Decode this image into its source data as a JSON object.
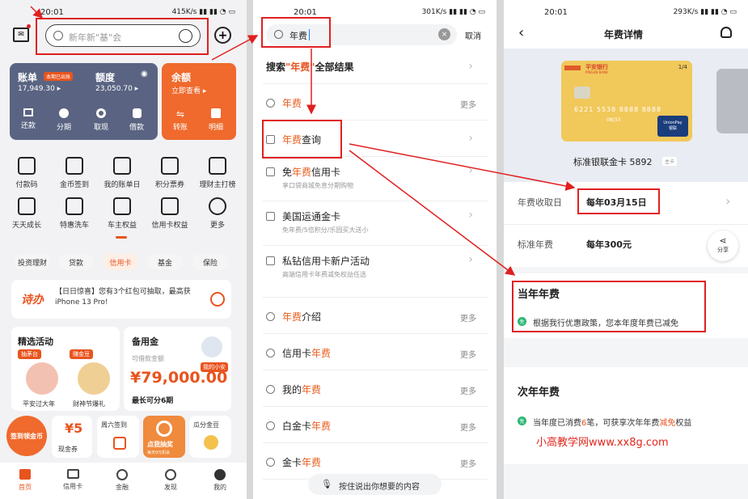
{
  "time": "20:01",
  "p1": {
    "speed": "415K/s",
    "search_placeholder": "新年新\"基\"会",
    "bill": {
      "label": "账单",
      "badge": "本期已出账",
      "value": "17,949.30 ▸",
      "quota_label": "额度",
      "quota_value": "23,050.70 ▸",
      "balance_label": "余额",
      "balance_value": "立即查看 ▸"
    },
    "quick": [
      "还款",
      "分期",
      "取现",
      "借款",
      "转账",
      "明细"
    ],
    "grid": [
      "付款码",
      "金币签到",
      "我的账单日",
      "积分票券",
      "理财主打榜",
      "天天成长",
      "特惠洗车",
      "车主权益",
      "信用卡权益",
      "更多"
    ],
    "chips": [
      "投资理财",
      "贷款",
      "信用卡",
      "基金",
      "保险"
    ],
    "promo": {
      "logo": "诗办",
      "text": "【日日惊喜】您有3个红包可抽取，最高获iPhone 13 Pro!"
    },
    "activity": {
      "title": "精选活动",
      "tag1": "抽茅台",
      "tag2": "赚金豆",
      "item1": "平安过大年",
      "item2": "财神节爆礼"
    },
    "reserve": {
      "title": "备用金",
      "sub": "可借款金额",
      "amount": "¥79,000.00",
      "term": "最长可分6期",
      "bot": "我的小安"
    },
    "bottom_cards": {
      "sign": "签到领金币",
      "cash_num": "¥5",
      "cash": "现金券",
      "week": "周六签到",
      "draw": "点我抽奖",
      "draw_sub": "每天0元机会",
      "gold": "瓜分金豆"
    },
    "tabs": [
      "首页",
      "信用卡",
      "金融",
      "发现",
      "我的"
    ]
  },
  "p2": {
    "speed": "301K/s",
    "query": "年费",
    "cancel": "取消",
    "all_pre": "搜索",
    "all_kw": "\"年费\"",
    "all_post": "全部结果",
    "rows": [
      {
        "pre": "",
        "kw": "年费",
        "post": "",
        "more": "更多",
        "sub": ""
      },
      {
        "pre": "",
        "kw": "年费",
        "post": "查询",
        "more": "",
        "sub": ""
      },
      {
        "pre": "免",
        "kw": "年费",
        "post": "信用卡",
        "more": "",
        "sub": "享口袋商城免息分期购物"
      },
      {
        "pre": "美国运通金卡",
        "kw": "",
        "post": "",
        "more": "",
        "sub": "免年费/5倍积分/乐园买大送小"
      },
      {
        "pre": "私钻信用卡新户活动",
        "kw": "",
        "post": "",
        "more": "",
        "sub": "高端信用卡年费减免权益任选"
      },
      {
        "pre": "",
        "kw": "年费",
        "post": "介绍",
        "more": "更多",
        "sub": ""
      },
      {
        "pre": "信用卡",
        "kw": "年费",
        "post": "",
        "more": "更多",
        "sub": ""
      },
      {
        "pre": "我的",
        "kw": "年费",
        "post": "",
        "more": "更多",
        "sub": ""
      },
      {
        "pre": "白金卡",
        "kw": "年费",
        "post": "",
        "more": "更多",
        "sub": ""
      },
      {
        "pre": "金卡",
        "kw": "年费",
        "post": "",
        "more": "更多",
        "sub": ""
      }
    ],
    "voice": "按住说出你想要的内容"
  },
  "p3": {
    "speed": "293K/s",
    "title": "年费详情",
    "card_index": "1/4",
    "card_name": "标准银联金卡 5892",
    "card_tag": "主卡",
    "bank": "平安银行",
    "bank_en": "PINGAN BANK",
    "card_num": "6221 5538 8888 8888",
    "card_date": "08/33",
    "unionpay": "UnionPay",
    "unionpay_cn": "银联",
    "fee_day_label": "年费收取日",
    "fee_day": "每年03月15日",
    "std_label": "标准年费",
    "std_value": "每年300元",
    "share": "分享",
    "cur_title": "当年年费",
    "cur_badge": "免",
    "cur_text": "根据我行优惠政策，您本年度年费已减免",
    "next_title": "次年年费",
    "next_badge": "免",
    "next_text_a": "当年度已消费",
    "next_count": "6",
    "next_text_b": "笔，可获享次年年费",
    "next_kw": "减免",
    "next_text_c": "权益",
    "watermark": "小高教学网www.xx8g.com"
  },
  "colors": {
    "accent": "#e8541e",
    "annot": "#e02020",
    "watermark": "#e0271d"
  }
}
